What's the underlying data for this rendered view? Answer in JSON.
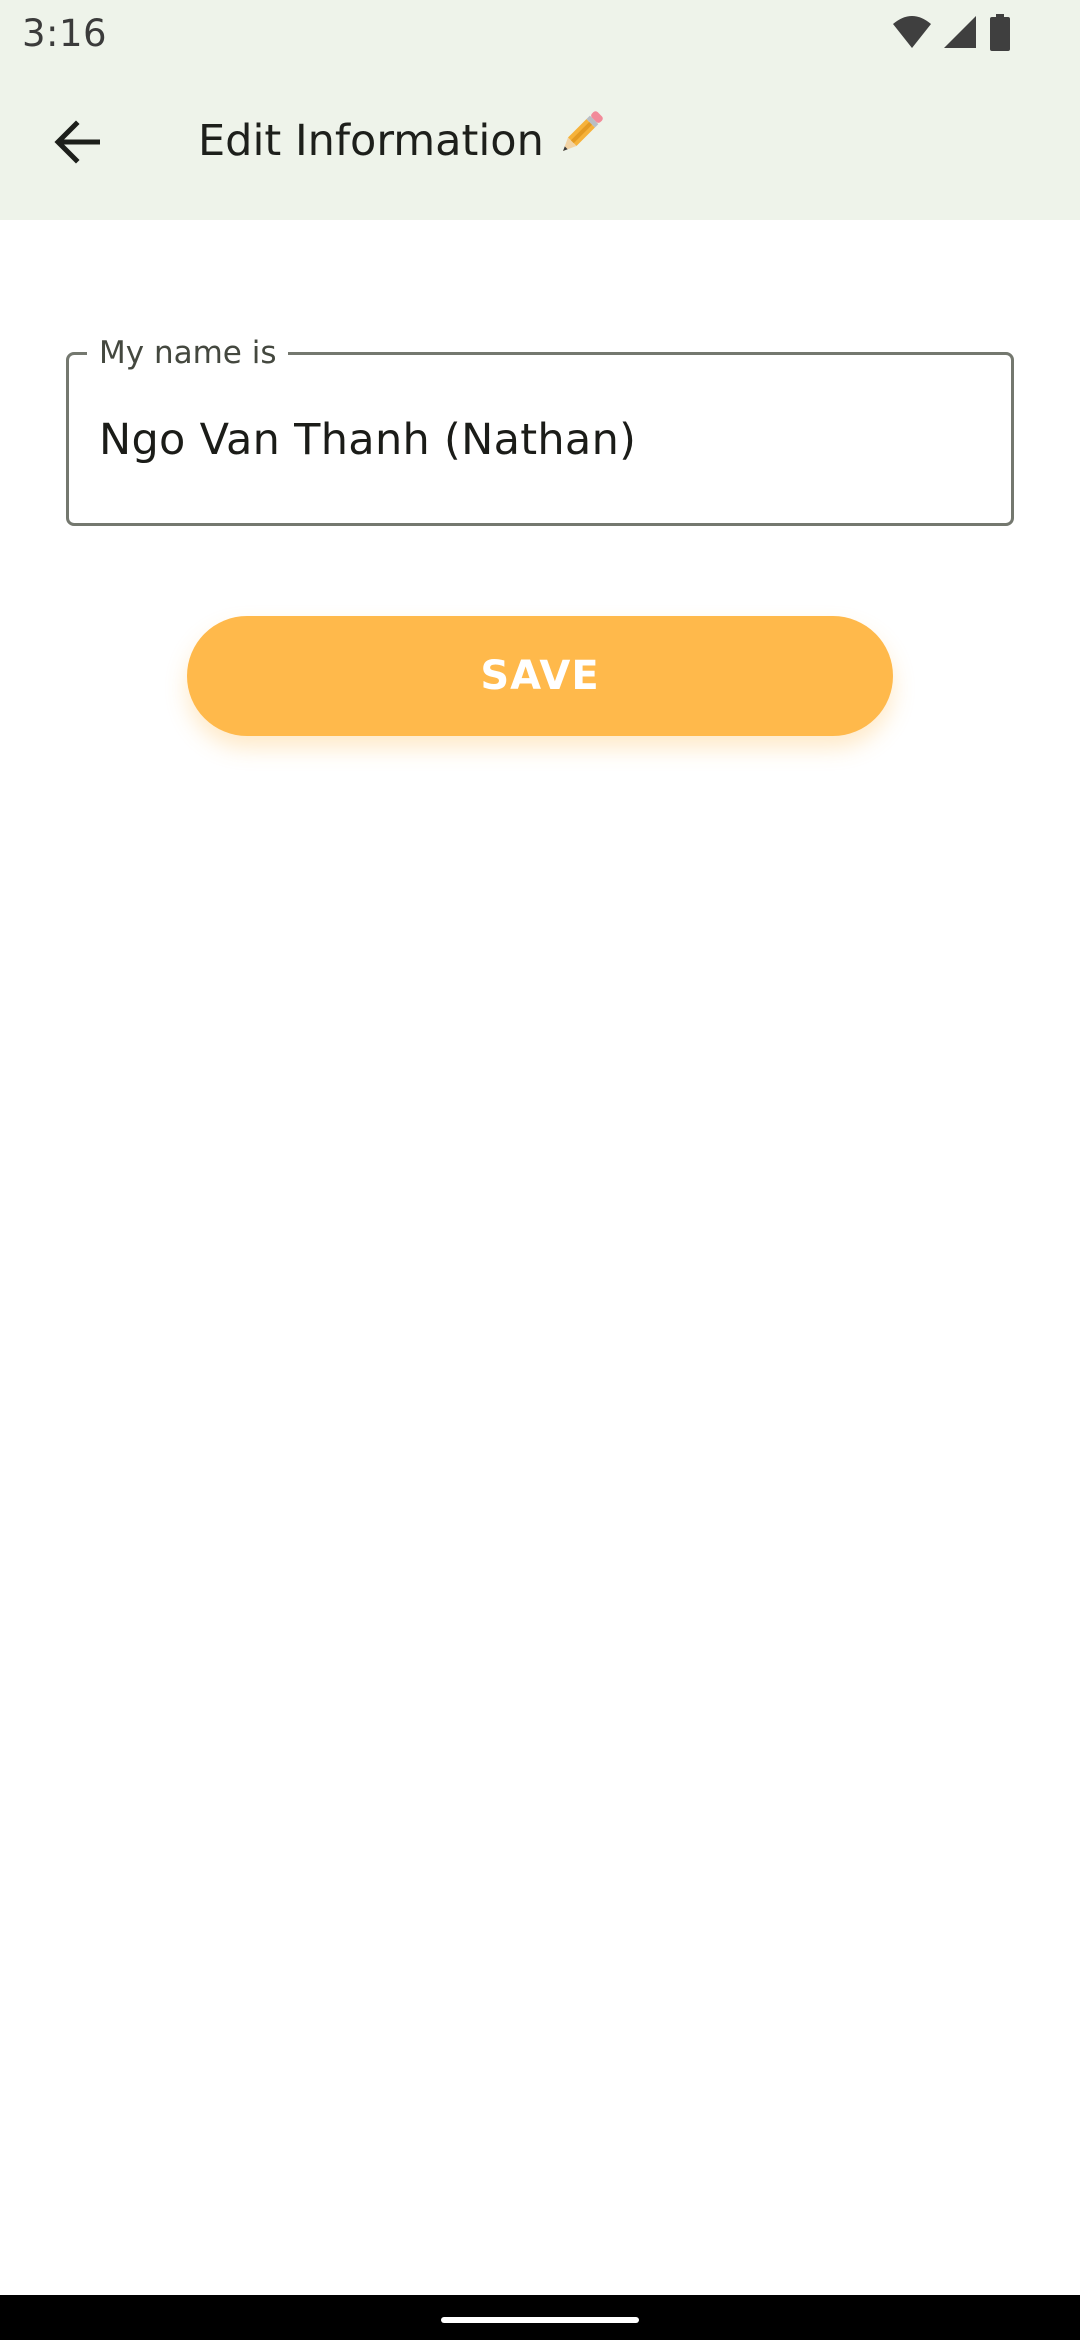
{
  "status_bar": {
    "time": "3:16",
    "icons": [
      "wifi-icon",
      "cellular-signal-icon",
      "battery-icon"
    ]
  },
  "app_bar": {
    "back_icon": "arrow-back-icon",
    "title": "Edit Information",
    "title_icon": "pencil-icon"
  },
  "form": {
    "name_label": "My name is",
    "name_value": "Ngo Van Thanh (Nathan)"
  },
  "save_button": {
    "label": "SAVE"
  },
  "colors": {
    "app_bar_background": "#eef3ea",
    "accent": "#ffb94b",
    "outline": "#74786f"
  }
}
